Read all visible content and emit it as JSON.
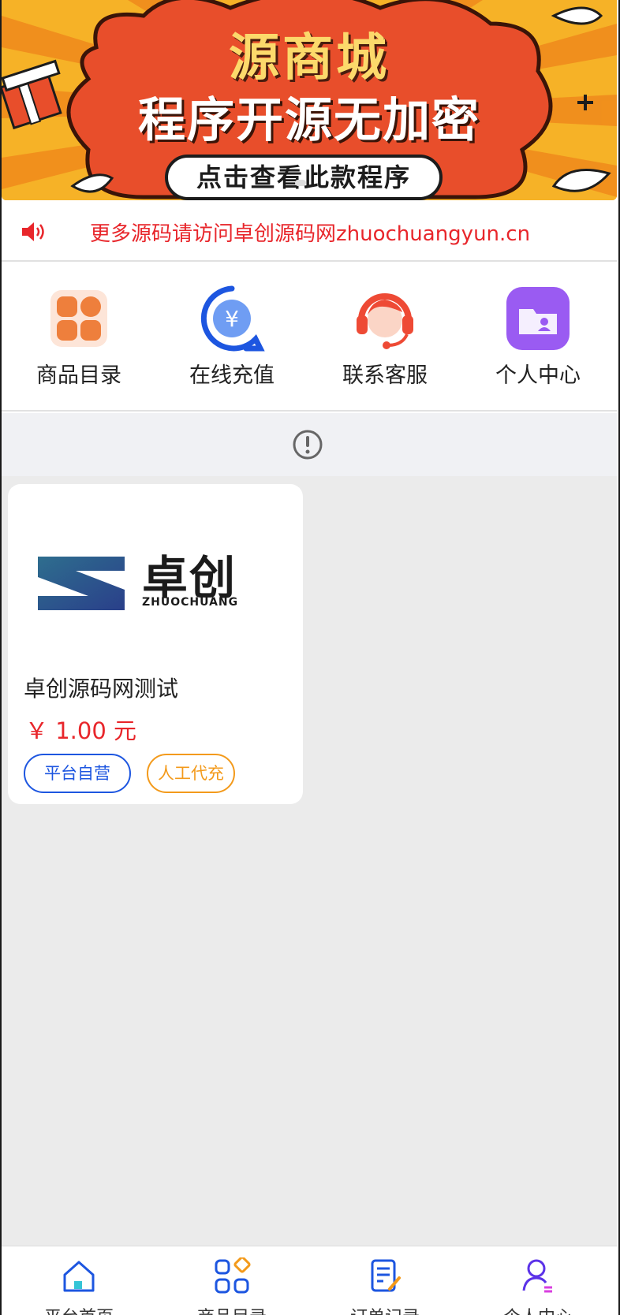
{
  "banner": {
    "title": "源商城",
    "subtitle": "程序开源无加密",
    "button_label": "点击查看此款程序"
  },
  "notice": {
    "text": "更多源码请访问卓创源码网zhuochuangyun.cn",
    "icon": "speaker-icon"
  },
  "quick_menu": [
    {
      "label": "商品目录",
      "icon": "catalog-grid-icon"
    },
    {
      "label": "在线充值",
      "icon": "yuan-recharge-icon"
    },
    {
      "label": "联系客服",
      "icon": "headset-support-icon"
    },
    {
      "label": "个人中心",
      "icon": "folder-user-icon"
    }
  ],
  "empty_bar": {
    "icon": "info-circle-icon"
  },
  "products": [
    {
      "logo_text": "卓创",
      "logo_sub": "ZHUOCHUANG",
      "name": "卓创源码网测试",
      "price": "￥ 1.00 元",
      "tags": [
        "平台自营",
        "人工代充"
      ]
    }
  ],
  "tabbar": [
    {
      "label": "平台首页",
      "icon": "home-icon"
    },
    {
      "label": "商品目录",
      "icon": "category-icon"
    },
    {
      "label": "订单记录",
      "icon": "order-edit-icon"
    },
    {
      "label": "个人中心",
      "icon": "user-icon"
    }
  ],
  "colors": {
    "accent_red": "#e8262b",
    "tag_blue": "#1d56e0",
    "tag_orange": "#f39a1b",
    "banner_orange": "#f6b227"
  }
}
